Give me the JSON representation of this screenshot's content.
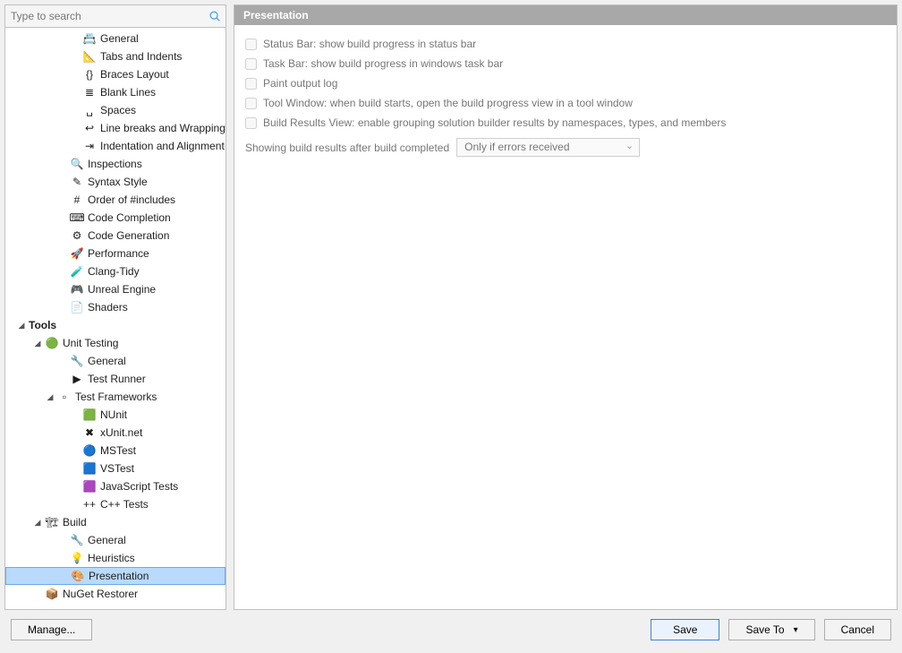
{
  "search": {
    "placeholder": "Type to search"
  },
  "tree": {
    "items": [
      {
        "indent": 72,
        "twisty": "",
        "icon": "📇",
        "label": "General"
      },
      {
        "indent": 72,
        "twisty": "",
        "icon": "📐",
        "label": "Tabs and Indents"
      },
      {
        "indent": 72,
        "twisty": "",
        "icon": "{}",
        "label": "Braces Layout"
      },
      {
        "indent": 72,
        "twisty": "",
        "icon": "≣",
        "label": "Blank Lines"
      },
      {
        "indent": 72,
        "twisty": "",
        "icon": "␣",
        "label": "Spaces"
      },
      {
        "indent": 72,
        "twisty": "",
        "icon": "↩",
        "label": "Line breaks and Wrapping"
      },
      {
        "indent": 72,
        "twisty": "",
        "icon": "⇥",
        "label": "Indentation and Alignment"
      },
      {
        "indent": 58,
        "twisty": "",
        "icon": "🔍",
        "label": "Inspections"
      },
      {
        "indent": 58,
        "twisty": "",
        "icon": "✎",
        "label": "Syntax Style"
      },
      {
        "indent": 58,
        "twisty": "",
        "icon": "#",
        "label": "Order of #includes"
      },
      {
        "indent": 58,
        "twisty": "",
        "icon": "⌨",
        "label": "Code Completion"
      },
      {
        "indent": 58,
        "twisty": "",
        "icon": "⚙",
        "label": "Code Generation"
      },
      {
        "indent": 58,
        "twisty": "",
        "icon": "🚀",
        "label": "Performance"
      },
      {
        "indent": 58,
        "twisty": "",
        "icon": "🧪",
        "label": "Clang-Tidy"
      },
      {
        "indent": 58,
        "twisty": "",
        "icon": "🎮",
        "label": "Unreal Engine"
      },
      {
        "indent": 58,
        "twisty": "",
        "icon": "📄",
        "label": "Shaders"
      },
      {
        "indent": 12,
        "twisty": "◢",
        "icon": "",
        "label": "Tools",
        "bold": true
      },
      {
        "indent": 30,
        "twisty": "◢",
        "icon": "🟢",
        "label": "Unit Testing"
      },
      {
        "indent": 58,
        "twisty": "",
        "icon": "🔧",
        "label": "General"
      },
      {
        "indent": 58,
        "twisty": "",
        "icon": "▶",
        "label": "Test Runner"
      },
      {
        "indent": 44,
        "twisty": "◢",
        "icon": "▫",
        "label": "Test Frameworks"
      },
      {
        "indent": 72,
        "twisty": "",
        "icon": "🟩",
        "label": "NUnit"
      },
      {
        "indent": 72,
        "twisty": "",
        "icon": "✖",
        "label": "xUnit.net"
      },
      {
        "indent": 72,
        "twisty": "",
        "icon": "🔵",
        "label": "MSTest"
      },
      {
        "indent": 72,
        "twisty": "",
        "icon": "🟦",
        "label": "VSTest"
      },
      {
        "indent": 72,
        "twisty": "",
        "icon": "🟪",
        "label": "JavaScript Tests"
      },
      {
        "indent": 72,
        "twisty": "",
        "icon": "++",
        "label": "C++ Tests"
      },
      {
        "indent": 30,
        "twisty": "◢",
        "icon": "🏗",
        "label": "Build"
      },
      {
        "indent": 58,
        "twisty": "",
        "icon": "🔧",
        "label": "General"
      },
      {
        "indent": 58,
        "twisty": "",
        "icon": "💡",
        "label": "Heuristics"
      },
      {
        "indent": 58,
        "twisty": "",
        "icon": "🎨",
        "label": "Presentation",
        "selected": true
      },
      {
        "indent": 30,
        "twisty": "",
        "icon": "📦",
        "label": "NuGet Restorer"
      }
    ]
  },
  "pane": {
    "title": "Presentation",
    "checks": [
      "Status Bar: show build progress in status bar",
      "Task Bar: show build progress in windows task bar",
      "Paint output log",
      "Tool Window: when build starts, open the build progress view in a tool window",
      "Build Results View: enable grouping solution builder results by namespaces, types, and members"
    ],
    "comboLabel": "Showing build results after build completed",
    "comboValue": "Only if errors received"
  },
  "footer": {
    "manage": "Manage...",
    "save": "Save",
    "saveTo": "Save To",
    "cancel": "Cancel"
  }
}
